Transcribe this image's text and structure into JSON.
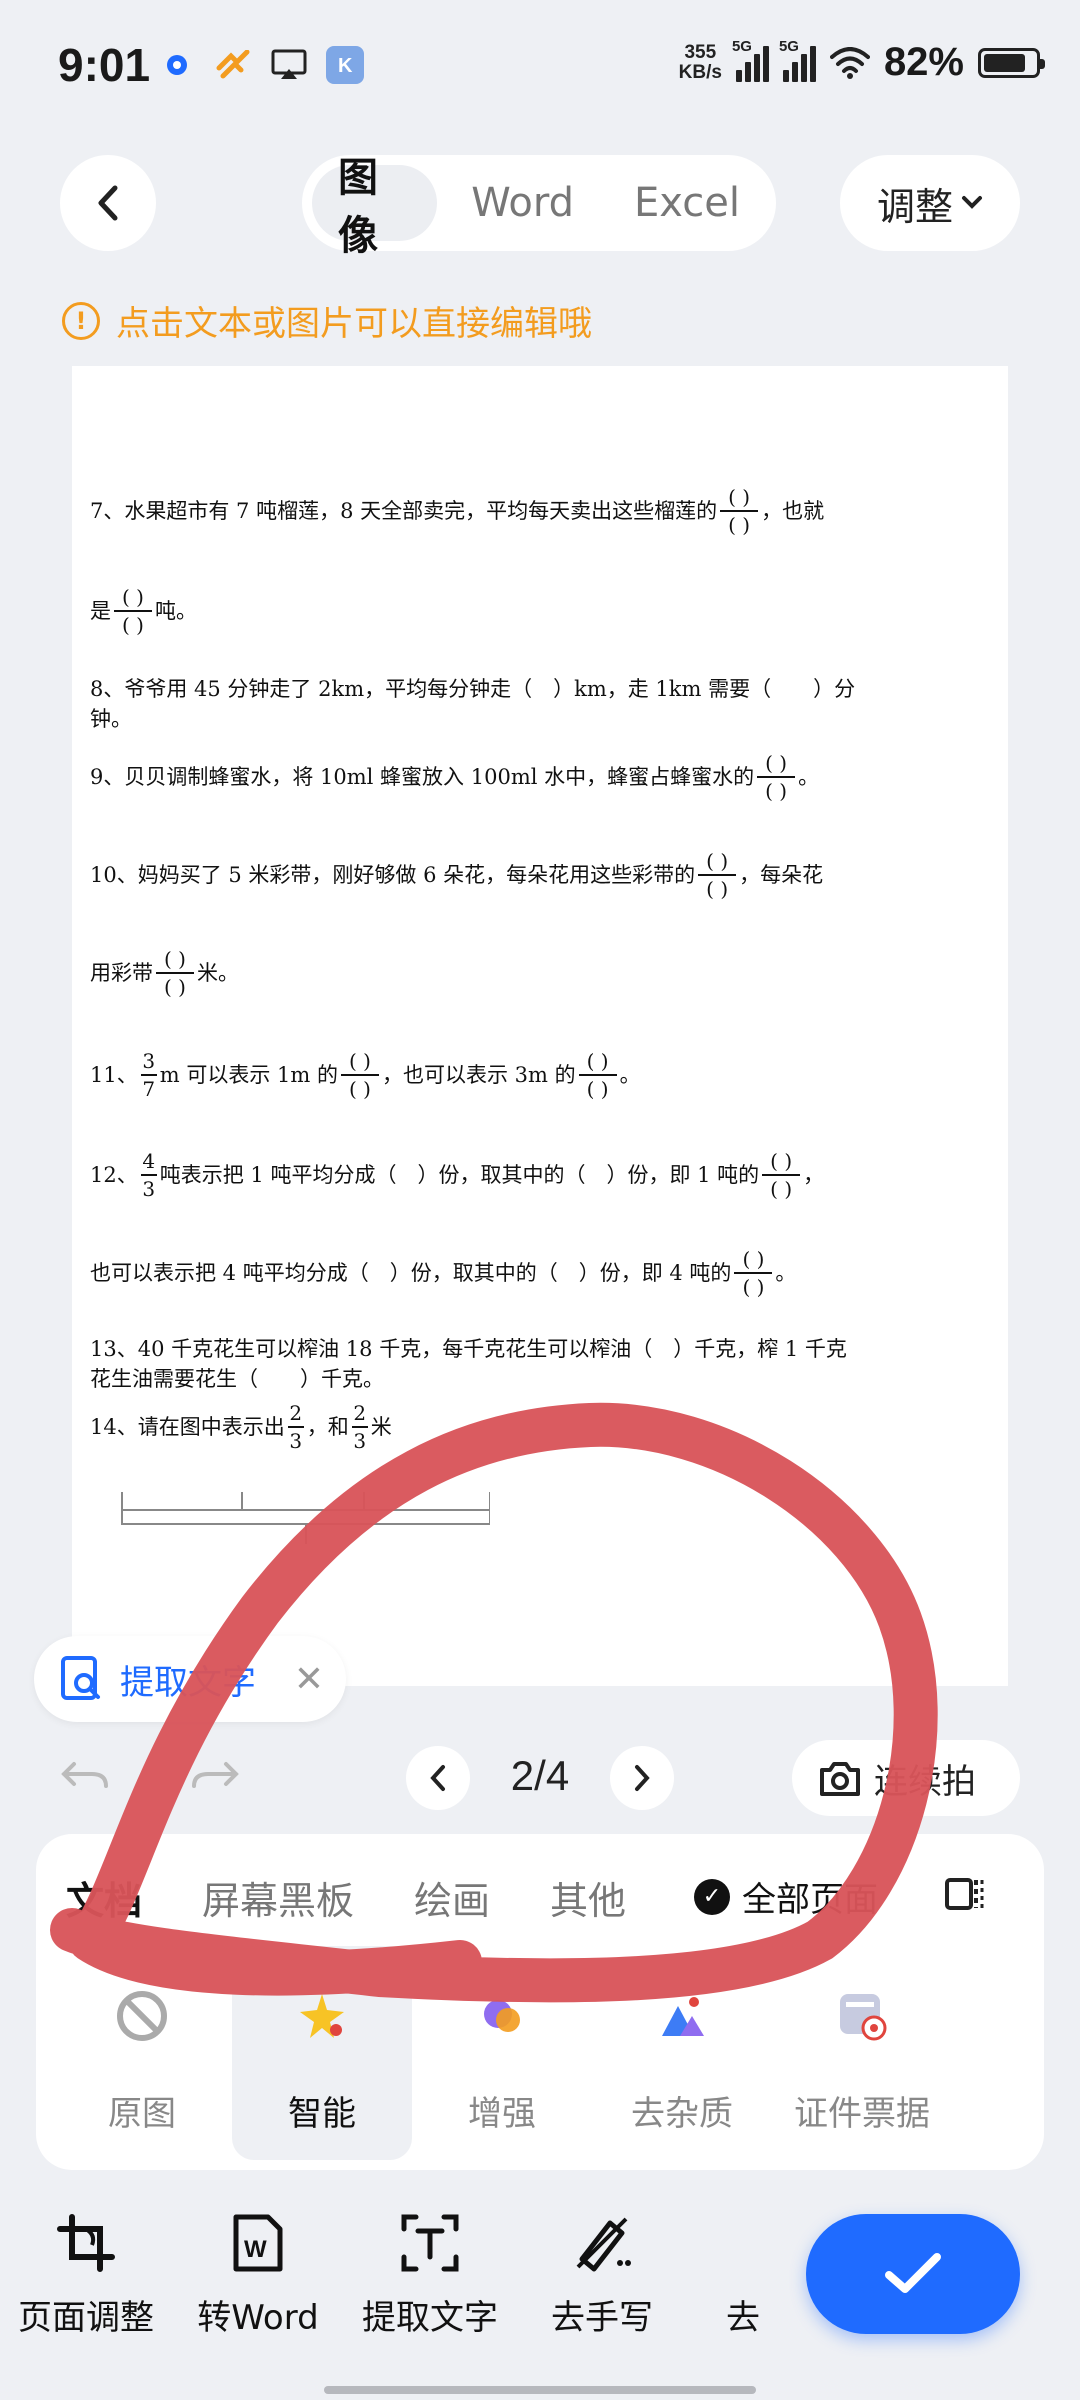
{
  "status": {
    "time": "9:01",
    "net_speed": "355",
    "net_unit": "KB/s",
    "sig1": "5G",
    "sig2": "5G",
    "battery_text": "82%",
    "battery_level": 0.82
  },
  "nav": {
    "tabs": [
      "图像",
      "Word",
      "Excel"
    ],
    "active_tab": "图像",
    "adjust_label": "调整"
  },
  "hint": "点击文本或图片可以直接编辑哦",
  "doc": {
    "q7a": "7、水果超市有 7 吨榴莲，8 天全部卖完，平均每天卖出这些榴莲的",
    "q7b": "，也就",
    "q7c": "是",
    "q7d": "吨。",
    "q8a": "8、爷爷用 45 分钟走了 2km，平均每分钟走（　）km，走 1km 需要（　　）分",
    "q8b": "钟。",
    "q9a": "9、贝贝调制蜂蜜水，将 10ml 蜂蜜放入 100ml 水中，蜂蜜占蜂蜜水的",
    "q9b": "。",
    "q10a": "10、妈妈买了 5 米彩带，刚好够做 6 朵花，每朵花用这些彩带的",
    "q10b": "，每朵花",
    "q10c": "用彩带",
    "q10d": "米。",
    "q11a": "11、",
    "q11_num": "3",
    "q11_den": "7",
    "q11b": "m 可以表示 1m 的",
    "q11c": "，也可以表示 3m 的",
    "q11d": "。",
    "q12a": "12、",
    "q12_num": "4",
    "q12_den": "3",
    "q12b": "吨表示把 1 吨平均分成（　）份，取其中的（　）份，即 1 吨的",
    "q12c": "，",
    "q12d": "也可以表示把 4 吨平均分成（　）份，取其中的（　）份，即 4 吨的",
    "q12e": "。",
    "q13a": "13、40 千克花生可以榨油 18 千克，每千克花生可以榨油（　）千克，榨 1 千克",
    "q13b": "花生油需要花生（　　）千克。",
    "q14a": "14、请在图中表示出",
    "q14_num1": "2",
    "q14_den1": "3",
    "q14b": "，和",
    "q14_num2": "2",
    "q14_den2": "3",
    "q14c": "米",
    "blank_paren": "( )"
  },
  "extract_chip": "提取文字",
  "pager": {
    "current": "2/4"
  },
  "continuous_label": "连续拍",
  "panel": {
    "tabs": [
      "文档",
      "屏幕黑板",
      "绘画",
      "其他"
    ],
    "active_tab": "文档",
    "apply_all": "全部页面",
    "filters": [
      {
        "label": "原图",
        "icon": "no-filter-icon"
      },
      {
        "label": "智能",
        "icon": "smart-icon"
      },
      {
        "label": "增强",
        "icon": "enhance-icon"
      },
      {
        "label": "去杂质",
        "icon": "remove-noise-icon"
      },
      {
        "label": "证件票据",
        "icon": "id-document-icon"
      }
    ],
    "selected_filter": "智能"
  },
  "toolbar": [
    {
      "label": "页面调整",
      "icon": "crop-icon"
    },
    {
      "label": "转Word",
      "icon": "word-icon"
    },
    {
      "label": "提取文字",
      "icon": "text-extract-icon"
    },
    {
      "label": "去手写",
      "icon": "erase-handwriting-icon"
    },
    {
      "label": "去",
      "icon": "more-icon"
    }
  ],
  "colors": {
    "accent": "#1f6bff",
    "hint": "#f39c1f",
    "annotation": "#d9545a"
  }
}
